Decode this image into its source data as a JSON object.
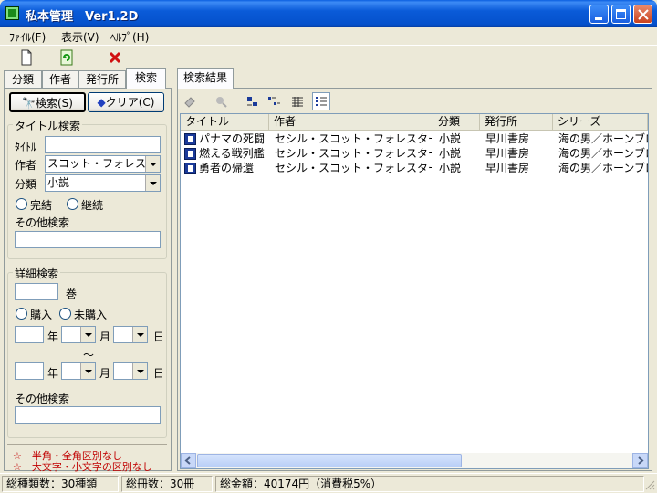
{
  "window": {
    "title": "私本管理　Ver1.2D"
  },
  "menu": {
    "file": "ﾌｧｲﾙ(F)",
    "view": "表示(V)",
    "help": "ﾍﾙﾌﾟ(H)"
  },
  "toolbar": {
    "new_icon": "new-file-icon",
    "refresh_icon": "refresh-icon",
    "delete_icon": "delete-x-icon"
  },
  "left_tabs": [
    "分類",
    "作者",
    "発行所",
    "検索"
  ],
  "left_active_tab": "検索",
  "search": {
    "search_button": "検索(S)",
    "clear_button": "クリア(C)",
    "title_group": "タイトル検索",
    "title_label": "ﾀｲﾄﾙ",
    "title_value": "",
    "author_label": "作者",
    "author_value": "スコット・フォレスター",
    "category_label": "分類",
    "category_value": "小説",
    "complete_label": "完結",
    "continue_label": "継続",
    "other_label": "その他検索",
    "other_value": ""
  },
  "detail": {
    "group": "詳細検索",
    "volume_label": "巻",
    "volume_value": "",
    "bought_label": "購入",
    "not_bought_label": "未購入",
    "year_label": "年",
    "month_label": "月",
    "day_label": "日",
    "tilde": "〜",
    "other_label": "その他検索",
    "other_value": ""
  },
  "notes": [
    "☆　半角・全角区別なし",
    "☆　大文字・小文字の区別なし"
  ],
  "right_tab": "検索結果",
  "columns": [
    "タイトル",
    "作者",
    "分類",
    "発行所",
    "シリーズ"
  ],
  "rows": [
    {
      "title": "パナマの死闘",
      "author": "セシル・スコット・フォレスター",
      "category": "小説",
      "publisher": "早川書房",
      "series": "海の男／ホーンブロワー"
    },
    {
      "title": "燃える戦列艦",
      "author": "セシル・スコット・フォレスター",
      "category": "小説",
      "publisher": "早川書房",
      "series": "海の男／ホーンブロワー"
    },
    {
      "title": "勇者の帰還",
      "author": "セシル・スコット・フォレスター",
      "category": "小説",
      "publisher": "早川書房",
      "series": "海の男／ホーンブロワー"
    }
  ],
  "status": {
    "total_kinds": "総種類数：30種類",
    "total_books": "総冊数：30冊",
    "total_amount": "総金額：40174円（消費税5%）"
  }
}
